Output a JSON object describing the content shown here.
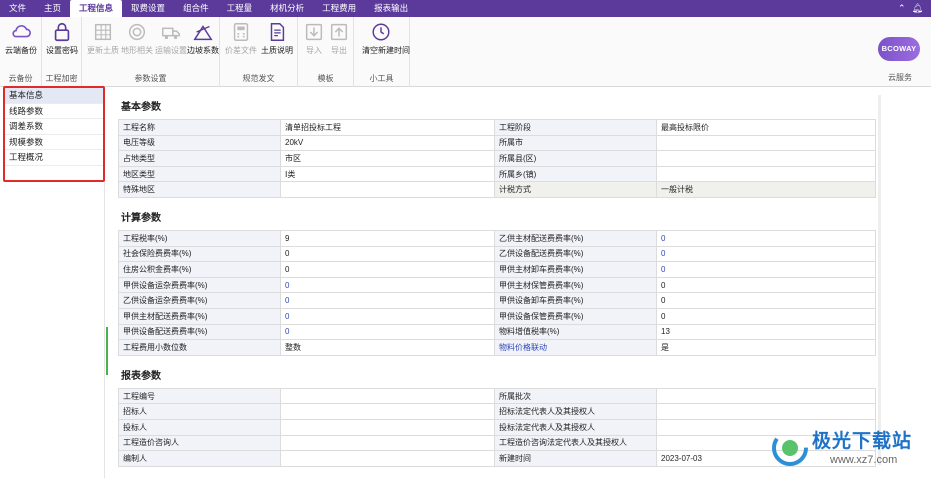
{
  "menu": {
    "tabs": [
      "文件",
      "主页",
      "工程信息",
      "取费设置",
      "组合件",
      "工程量",
      "材机分析",
      "工程费用",
      "报表输出"
    ],
    "active_index": 2
  },
  "ribbon": {
    "groups": [
      "云备份",
      "工程加密",
      "参数设置",
      "规范发文",
      "模板",
      "小工具",
      "云服务"
    ],
    "buttons": [
      "云端备份",
      "设置密码",
      "更新土质",
      "地形相关",
      "运输设置",
      "边坡系数",
      "价差文件",
      "土质说明",
      "导入",
      "导出",
      "清空新建时间"
    ],
    "brand": "BCOWAY",
    "colors": {
      "accent": "#5b3a9b",
      "brand": "#7b52c8"
    }
  },
  "sidebar": {
    "items": [
      "基本信息",
      "线路参数",
      "调差系数",
      "规模参数",
      "工程概况"
    ],
    "selected_index": 0
  },
  "sections": [
    {
      "title": "基本参数",
      "rows": [
        [
          "工程名称",
          "清单招投标工程",
          "工程阶段",
          "最高投标限价"
        ],
        [
          "电压等级",
          "20kV",
          "所属市",
          ""
        ],
        [
          "占地类型",
          "市区",
          "所属县(区)",
          ""
        ],
        [
          "地区类型",
          "Ⅰ类",
          "所属乡(镇)",
          ""
        ],
        [
          "特殊地区",
          "",
          "计税方式",
          "一般计税"
        ]
      ]
    },
    {
      "title": "计算参数",
      "rows": [
        [
          "工程税率(%)",
          "9",
          "乙供主材配送费费率(%)",
          "0"
        ],
        [
          "社会保险费费率(%)",
          "0",
          "乙供设备配送费费率(%)",
          "0"
        ],
        [
          "住房公积金费率(%)",
          "0",
          "甲供主材卸车费费率(%)",
          "0"
        ],
        [
          "甲供设备运杂费费率(%)",
          "0",
          "甲供主材保管费费率(%)",
          "0"
        ],
        [
          "乙供设备运杂费费率(%)",
          "0",
          "甲供设备卸车费费率(%)",
          "0"
        ],
        [
          "甲供主材配送费费率(%)",
          "0",
          "甲供设备保管费费率(%)",
          "0"
        ],
        [
          "甲供设备配送费费率(%)",
          "0",
          "物料增值税率(%)",
          "13"
        ],
        [
          "工程费用小数位数",
          "整数",
          "物料价格联动",
          "是"
        ]
      ]
    },
    {
      "title": "报表参数",
      "rows": [
        [
          "工程编号",
          "",
          "所属批次",
          ""
        ],
        [
          "招标人",
          "",
          "招标法定代表人及其授权人",
          ""
        ],
        [
          "投标人",
          "",
          "投标法定代表人及其授权人",
          ""
        ],
        [
          "工程造价咨询人",
          "",
          "工程造价咨询法定代表人及其授权人",
          ""
        ],
        [
          "编制人",
          "",
          "新建时间",
          "2023-07-03"
        ]
      ]
    }
  ],
  "watermark": {
    "name": "极光下载站",
    "url": "www.xz7.com"
  }
}
